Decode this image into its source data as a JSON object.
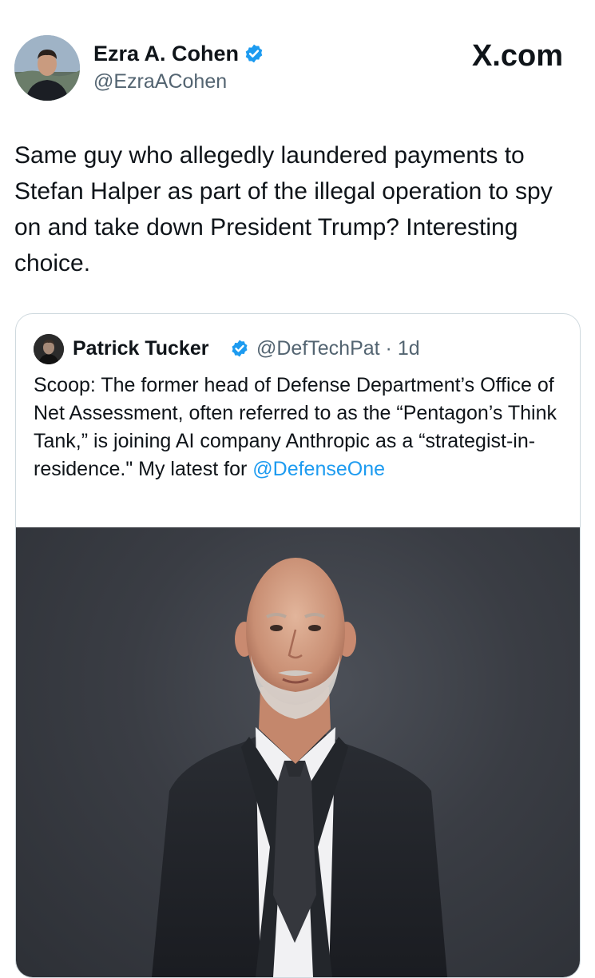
{
  "tweet": {
    "author": {
      "name": "Ezra A. Cohen",
      "handle": "@EzraACohen",
      "verified": true,
      "avatar_icon": "profile-photo"
    },
    "site_logo": "X.com",
    "text": "Same guy who allegedly laundered payments to Stefan Halper as part of the illegal operation to spy on and take down President Trump? Interesting choice.",
    "quoted_tweet": {
      "author": {
        "name": "Patrick Tucker",
        "handle": "@DefTechPat",
        "verified": true,
        "avatar_icon": "profile-photo"
      },
      "meta": "@DefTechPat · 1d",
      "text_main": "Scoop: The former head of Defense Department’s Office of Net Assessment, often referred to as the “Pentagon’s Think Tank,” is joining AI company Anthropic as a “strategist-in-residence.\" My latest for ",
      "mention": "@DefenseOne",
      "image_icon": "portrait-photo"
    }
  },
  "colors": {
    "text": "#0f1419",
    "secondary": "#536471",
    "link": "#1d9bf0",
    "verified": "#1d9bf0",
    "border": "#cfd9de"
  }
}
